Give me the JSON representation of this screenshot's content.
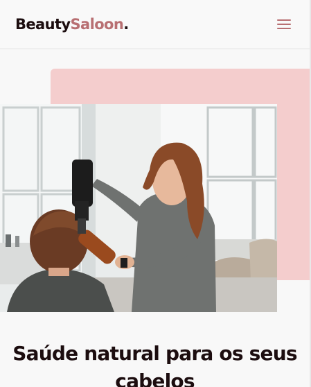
{
  "header": {
    "logo": {
      "part1": "Beauty",
      "part2": "Saloon",
      "part3": "."
    },
    "menu_icon": "hamburger-menu-icon",
    "colors": {
      "brand_dark": "#1c0d0f",
      "brand_accent": "#b86f72",
      "pink_block": "#f4cdcd"
    }
  },
  "hero": {
    "image_subject": "hairdresser-blow-drying-client-photo",
    "headline": "Saúde natural para os seus cabelos"
  }
}
